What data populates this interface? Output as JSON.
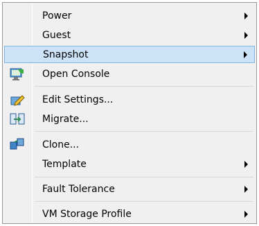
{
  "menu": {
    "items": [
      {
        "label": "Power",
        "submenu": true
      },
      {
        "label": "Guest",
        "submenu": true
      },
      {
        "label": "Snapshot",
        "submenu": true,
        "highlighted": true
      },
      {
        "label": "Open Console",
        "icon": "console-icon"
      },
      {
        "label": "Edit Settings...",
        "icon": "edit-settings-icon"
      },
      {
        "label": "Migrate...",
        "icon": "migrate-icon"
      },
      {
        "label": "Clone...",
        "icon": "clone-icon"
      },
      {
        "label": "Template",
        "submenu": true
      },
      {
        "label": "Fault Tolerance",
        "submenu": true
      },
      {
        "label": "VM Storage Profile",
        "submenu": true
      }
    ]
  },
  "colors": {
    "highlight_bg": "#cce3f7",
    "highlight_border": "#82b4e2",
    "menu_bg": "#f0f0f0"
  }
}
